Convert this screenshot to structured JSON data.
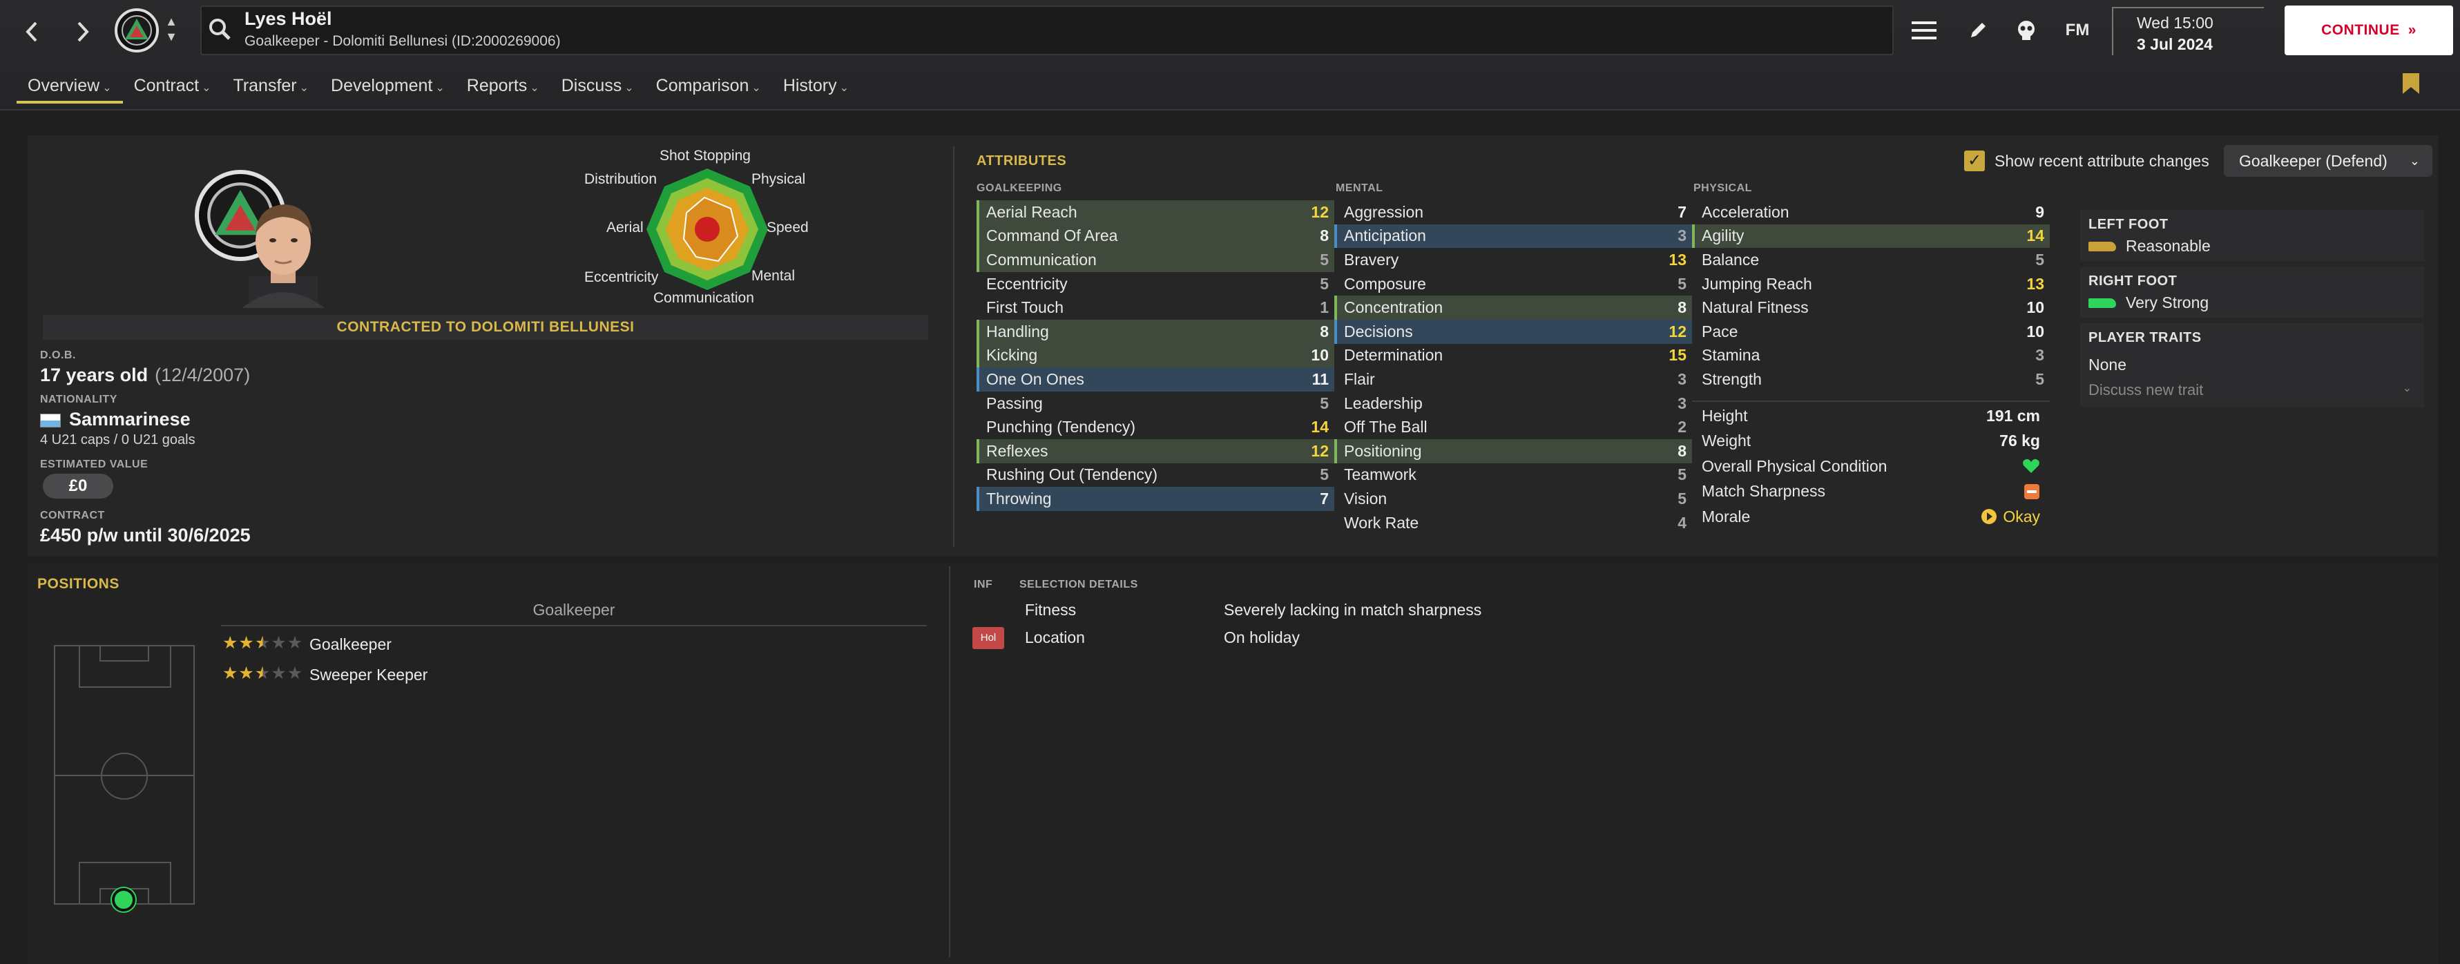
{
  "header": {
    "player_name": "Lyes Hoël",
    "player_subtitle": "Goalkeeper - Dolomiti Bellunesi (ID:2000269006)",
    "time": "Wed 15:00",
    "date": "3 Jul 2024",
    "fm_label": "FM",
    "continue_label": "CONTINUE",
    "icons": {
      "back": "chevron-left-icon",
      "forward": "chevron-right-icon",
      "menu": "hamburger-menu-icon",
      "edit": "pencil-icon",
      "skull": "skull-icon",
      "search": "magnifier-icon"
    }
  },
  "tabs": [
    {
      "label": "Overview",
      "active": true
    },
    {
      "label": "Contract"
    },
    {
      "label": "Transfer"
    },
    {
      "label": "Development"
    },
    {
      "label": "Reports"
    },
    {
      "label": "Discuss"
    },
    {
      "label": "Comparison"
    },
    {
      "label": "History"
    }
  ],
  "profile": {
    "contract_banner": "CONTRACTED TO DOLOMITI BELLUNESI",
    "dob_label": "D.O.B.",
    "age": "17 years old",
    "dob": "(12/4/2007)",
    "nationality_label": "NATIONALITY",
    "nationality": "Sammarinese",
    "caps": "4 U21 caps / 0 U21 goals",
    "value_label": "ESTIMATED VALUE",
    "value": "£0",
    "contract_label": "CONTRACT",
    "contract": "£450 p/w until 30/6/2025"
  },
  "radar": {
    "labels": [
      "Shot Stopping",
      "Physical",
      "Speed",
      "Mental",
      "Communication",
      "Eccentricity",
      "Aerial",
      "Distribution"
    ],
    "colors": {
      "outer": "#1f9e3a",
      "mid": "#8fc43a",
      "inner": "#e0a020",
      "core": "#d98b1e",
      "dot": "#cc1f1f"
    }
  },
  "attributes": {
    "title": "ATTRIBUTES",
    "show_changes_label": "Show recent attribute changes",
    "role_dropdown": "Goalkeeper (Defend)",
    "goalkeeping_header": "GOALKEEPING",
    "mental_header": "MENTAL",
    "physical_header": "PHYSICAL",
    "goalkeeping": [
      {
        "name": "Aerial Reach",
        "value": "12",
        "hl": "g"
      },
      {
        "name": "Command Of Area",
        "value": "8",
        "hl": "g"
      },
      {
        "name": "Communication",
        "value": "5",
        "hl": "g"
      },
      {
        "name": "Eccentricity",
        "value": "5",
        "hl": ""
      },
      {
        "name": "First Touch",
        "value": "1",
        "hl": ""
      },
      {
        "name": "Handling",
        "value": "8",
        "hl": "g"
      },
      {
        "name": "Kicking",
        "value": "10",
        "hl": "g"
      },
      {
        "name": "One On Ones",
        "value": "11",
        "hl": "b"
      },
      {
        "name": "Passing",
        "value": "5",
        "hl": ""
      },
      {
        "name": "Punching (Tendency)",
        "value": "14",
        "hl": ""
      },
      {
        "name": "Reflexes",
        "value": "12",
        "hl": "g"
      },
      {
        "name": "Rushing Out (Tendency)",
        "value": "5",
        "hl": ""
      },
      {
        "name": "Throwing",
        "value": "7",
        "hl": "b"
      }
    ],
    "mental": [
      {
        "name": "Aggression",
        "value": "7",
        "hl": ""
      },
      {
        "name": "Anticipation",
        "value": "3",
        "hl": "b"
      },
      {
        "name": "Bravery",
        "value": "13",
        "hl": ""
      },
      {
        "name": "Composure",
        "value": "5",
        "hl": ""
      },
      {
        "name": "Concentration",
        "value": "8",
        "hl": "g"
      },
      {
        "name": "Decisions",
        "value": "12",
        "hl": "b"
      },
      {
        "name": "Determination",
        "value": "15",
        "hl": ""
      },
      {
        "name": "Flair",
        "value": "3",
        "hl": ""
      },
      {
        "name": "Leadership",
        "value": "3",
        "hl": ""
      },
      {
        "name": "Off The Ball",
        "value": "2",
        "hl": ""
      },
      {
        "name": "Positioning",
        "value": "8",
        "hl": "g"
      },
      {
        "name": "Teamwork",
        "value": "5",
        "hl": ""
      },
      {
        "name": "Vision",
        "value": "5",
        "hl": ""
      },
      {
        "name": "Work Rate",
        "value": "4",
        "hl": ""
      }
    ],
    "physical": [
      {
        "name": "Acceleration",
        "value": "9",
        "hl": ""
      },
      {
        "name": "Agility",
        "value": "14",
        "hl": "g"
      },
      {
        "name": "Balance",
        "value": "5",
        "hl": ""
      },
      {
        "name": "Jumping Reach",
        "value": "13",
        "hl": ""
      },
      {
        "name": "Natural Fitness",
        "value": "10",
        "hl": ""
      },
      {
        "name": "Pace",
        "value": "10",
        "hl": ""
      },
      {
        "name": "Stamina",
        "value": "3",
        "hl": ""
      },
      {
        "name": "Strength",
        "value": "5",
        "hl": ""
      }
    ],
    "physical_extra": {
      "height_label": "Height",
      "height": "191 cm",
      "weight_label": "Weight",
      "weight": "76 kg",
      "condition_label": "Overall Physical Condition",
      "sharpness_label": "Match Sharpness",
      "morale_label": "Morale",
      "morale": "Okay"
    }
  },
  "side": {
    "left_foot_label": "LEFT FOOT",
    "left_foot": "Reasonable",
    "right_foot_label": "RIGHT FOOT",
    "right_foot": "Very Strong",
    "traits_label": "PLAYER TRAITS",
    "traits": "None",
    "discuss_trait": "Discuss new trait"
  },
  "positions": {
    "title": "POSITIONS",
    "group": "Goalkeeper",
    "roles": [
      {
        "name": "Goalkeeper",
        "stars": 2.5
      },
      {
        "name": "Sweeper Keeper",
        "stars": 2.5
      }
    ]
  },
  "selection": {
    "inf_header": "INF",
    "details_header": "SELECTION DETAILS",
    "rows": [
      {
        "label": "Fitness",
        "value": "Severely lacking in match sharpness",
        "badge": ""
      },
      {
        "label": "Location",
        "value": "On holiday",
        "badge": "Hol"
      }
    ]
  }
}
